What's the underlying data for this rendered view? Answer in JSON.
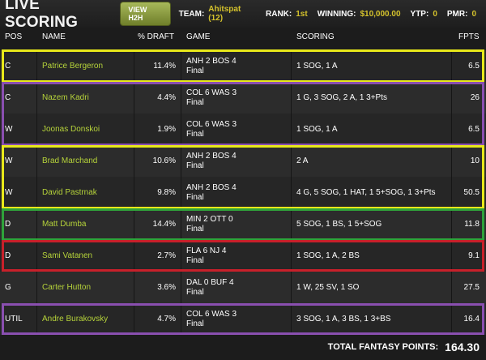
{
  "header": {
    "title": "LIVE SCORING",
    "h2h_button": "VIEW H2H",
    "team_label": "TEAM:",
    "team_value": "Ahitspat (12)",
    "rank_label": "RANK:",
    "rank_value": "1st",
    "winning_label": "WINNING:",
    "winning_value": "$10,000.00",
    "ytp_label": "YTP:",
    "ytp_value": "0",
    "pmr_label": "PMR:",
    "pmr_value": "0"
  },
  "columns": {
    "pos": "POS",
    "name": "NAME",
    "draft": "% DRAFT",
    "game": "GAME",
    "scoring": "SCORING",
    "fpts": "FPTS"
  },
  "rows": [
    {
      "pos": "C",
      "name": "Patrice Bergeron",
      "draft": "11.4%",
      "game": "ANH 2 BOS 4",
      "status": "Final",
      "scoring": "1 SOG, 1 A",
      "fpts": "6.5"
    },
    {
      "pos": "C",
      "name": "Nazem Kadri",
      "draft": "4.4%",
      "game": "COL 6 WAS 3",
      "status": "Final",
      "scoring": "1 G, 3 SOG, 2 A, 1 3+Pts",
      "fpts": "26"
    },
    {
      "pos": "W",
      "name": "Joonas Donskoi",
      "draft": "1.9%",
      "game": "COL 6 WAS 3",
      "status": "Final",
      "scoring": "1 SOG, 1 A",
      "fpts": "6.5"
    },
    {
      "pos": "W",
      "name": "Brad Marchand",
      "draft": "10.6%",
      "game": "ANH 2 BOS 4",
      "status": "Final",
      "scoring": "2 A",
      "fpts": "10"
    },
    {
      "pos": "W",
      "name": "David Pastrnak",
      "draft": "9.8%",
      "game": "ANH 2 BOS 4",
      "status": "Final",
      "scoring": "4 G, 5 SOG, 1 HAT, 1 5+SOG, 1 3+Pts",
      "fpts": "50.5"
    },
    {
      "pos": "D",
      "name": "Matt Dumba",
      "draft": "14.4%",
      "game": "MIN 2 OTT 0",
      "status": "Final",
      "scoring": "5 SOG, 1 BS, 1 5+SOG",
      "fpts": "11.8"
    },
    {
      "pos": "D",
      "name": "Sami Vatanen",
      "draft": "2.7%",
      "game": "FLA 6 NJ 4",
      "status": "Final",
      "scoring": "1 SOG, 1 A, 2 BS",
      "fpts": "9.1"
    },
    {
      "pos": "G",
      "name": "Carter Hutton",
      "draft": "3.6%",
      "game": "DAL 0 BUF 4",
      "status": "Final",
      "scoring": "1 W, 25 SV, 1 SO",
      "fpts": "27.5"
    },
    {
      "pos": "UTIL",
      "name": "Andre Burakovsky",
      "draft": "4.7%",
      "game": "COL 6 WAS 3",
      "status": "Final",
      "scoring": "3 SOG, 1 A, 3 BS, 1 3+BS",
      "fpts": "16.4"
    }
  ],
  "stack_colors": {
    "yellow": "#e8e81a",
    "purple": "#8a4fb0",
    "green": "#2fa23a",
    "red": "#c8202a"
  },
  "total": {
    "label": "TOTAL FANTASY POINTS:",
    "value": "164.30"
  }
}
